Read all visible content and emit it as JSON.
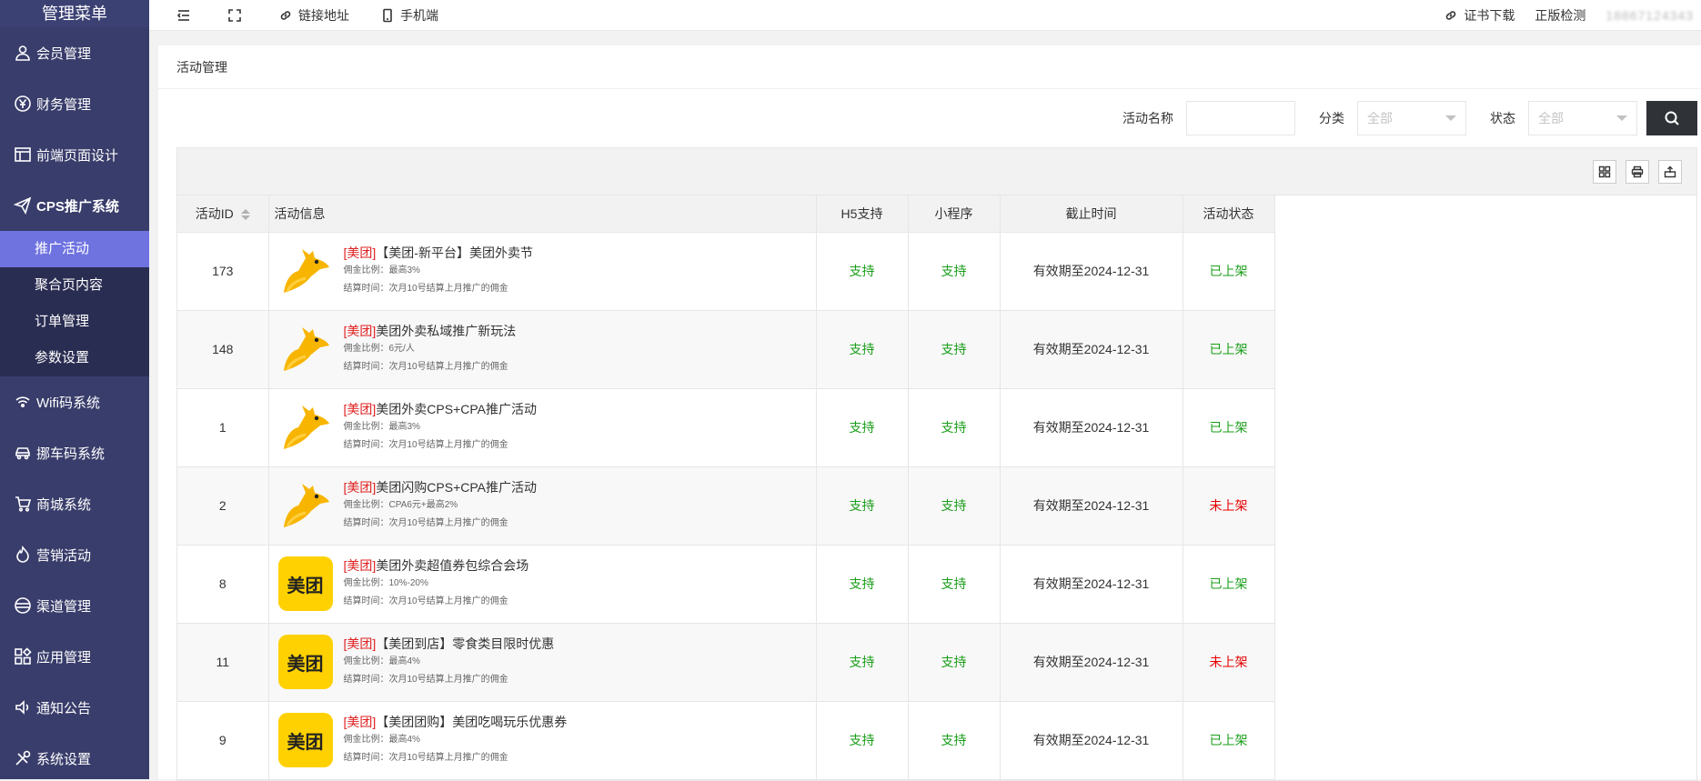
{
  "sidebar": {
    "title": "管理菜单",
    "items": [
      {
        "label": "会员管理",
        "icon": "user-icon"
      },
      {
        "label": "财务管理",
        "icon": "yen-icon"
      },
      {
        "label": "前端页面设计",
        "icon": "layout-icon"
      },
      {
        "label": "CPS推广系统",
        "icon": "send-icon"
      }
    ],
    "sub_items": [
      {
        "label": "推广活动",
        "active": true
      },
      {
        "label": "聚合页内容"
      },
      {
        "label": "订单管理"
      },
      {
        "label": "参数设置"
      }
    ],
    "items_after": [
      {
        "label": "Wifi码系统",
        "icon": "wifi-icon"
      },
      {
        "label": "挪车码系统",
        "icon": "car-icon"
      },
      {
        "label": "商城系统",
        "icon": "cart-icon"
      },
      {
        "label": "营销活动",
        "icon": "fire-icon"
      },
      {
        "label": "渠道管理",
        "icon": "channel-icon"
      },
      {
        "label": "应用管理",
        "icon": "apps-icon"
      },
      {
        "label": "通知公告",
        "icon": "speaker-icon"
      },
      {
        "label": "系统设置",
        "icon": "tools-icon"
      }
    ]
  },
  "topbar": {
    "link_label": "链接地址",
    "mobile_label": "手机端",
    "cert_label": "证书下载",
    "license_label": "正版检测",
    "user_label": "18867124343"
  },
  "page_title": "活动管理",
  "filters": {
    "name_label": "活动名称",
    "category_label": "分类",
    "category_value": "全部",
    "status_label": "状态",
    "status_value": "全部"
  },
  "table": {
    "headers": {
      "id": "活动ID",
      "info": "活动信息",
      "h5": "H5支持",
      "mini": "小程序",
      "end": "截止时间",
      "status": "活动状态"
    },
    "rows": [
      {
        "id": "173",
        "tag": "[美团]",
        "title": "【美团-新平台】美团外卖节",
        "commission": "佣金比例：最高3%",
        "settle": "结算时间：次月10号结算上月推广的佣金",
        "h5": "支持",
        "mini": "支持",
        "end": "有效期至2024-12-31",
        "status": "已上架",
        "logo": "kangaroo"
      },
      {
        "id": "148",
        "tag": "[美团]",
        "title": "美团外卖私域推广新玩法",
        "commission": "佣金比例：6元/人",
        "settle": "结算时间：次月10号结算上月推广的佣金",
        "h5": "支持",
        "mini": "支持",
        "end": "有效期至2024-12-31",
        "status": "已上架",
        "logo": "kangaroo"
      },
      {
        "id": "1",
        "tag": "[美团]",
        "title": "美团外卖CPS+CPA推广活动",
        "commission": "佣金比例：最高3%",
        "settle": "结算时间：次月10号结算上月推广的佣金",
        "h5": "支持",
        "mini": "支持",
        "end": "有效期至2024-12-31",
        "status": "已上架",
        "logo": "kangaroo"
      },
      {
        "id": "2",
        "tag": "[美团]",
        "title": "美团闪购CPS+CPA推广活动",
        "commission": "佣金比例：CPA6元+最高2%",
        "settle": "结算时间：次月10号结算上月推广的佣金",
        "h5": "支持",
        "mini": "支持",
        "end": "有效期至2024-12-31",
        "status": "未上架",
        "logo": "kangaroo"
      },
      {
        "id": "8",
        "tag": "[美团]",
        "title": "美团外卖超值券包综合会场",
        "commission": "佣金比例：10%-20%",
        "settle": "结算时间：次月10号结算上月推广的佣金",
        "h5": "支持",
        "mini": "支持",
        "end": "有效期至2024-12-31",
        "status": "已上架",
        "logo": "meituan"
      },
      {
        "id": "11",
        "tag": "[美团]",
        "title": "【美团到店】零食类目限时优惠",
        "commission": "佣金比例：最高4%",
        "settle": "结算时间：次月10号结算上月推广的佣金",
        "h5": "支持",
        "mini": "支持",
        "end": "有效期至2024-12-31",
        "status": "未上架",
        "logo": "meituan"
      },
      {
        "id": "9",
        "tag": "[美团]",
        "title": "【美团团购】美团吃喝玩乐优惠券",
        "commission": "佣金比例：最高4%",
        "settle": "结算时间：次月10号结算上月推广的佣金",
        "h5": "支持",
        "mini": "支持",
        "end": "有效期至2024-12-31",
        "status": "已上架",
        "logo": "meituan"
      }
    ],
    "meituan_logo_text": "美团"
  },
  "colors": {
    "sidebar_bg": "#393d6b",
    "sidebar_active": "#6f73e0",
    "status_on": "#1a9e1a",
    "status_off": "#e60000",
    "tag": "#e02020"
  }
}
